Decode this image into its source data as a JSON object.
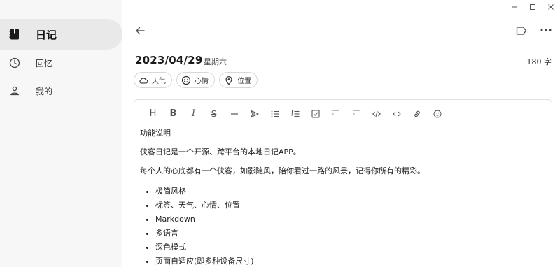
{
  "window": {
    "controls": [
      "minimize",
      "maximize",
      "close"
    ]
  },
  "sidebar": {
    "items": [
      {
        "label": "日记",
        "icon": "journal-icon",
        "active": true
      },
      {
        "label": "回忆",
        "icon": "clock-icon",
        "active": false
      },
      {
        "label": "我的",
        "icon": "person-icon",
        "active": false
      }
    ]
  },
  "entry": {
    "date": "2023/04/29",
    "weekday": "星期六",
    "word_count": "180 字",
    "chips": [
      {
        "label": "天气",
        "icon": "cloud-icon"
      },
      {
        "label": "心情",
        "icon": "smiley-icon"
      },
      {
        "label": "位置",
        "icon": "location-pin-icon"
      }
    ]
  },
  "toolbar": {
    "heading": "H",
    "bold": "B",
    "italic": "I",
    "strike": "S"
  },
  "content": {
    "title": "功能说明",
    "para1": "侠客日记是一个开源、跨平台的本地日记APP。",
    "para2": "每个人的心底都有一个侠客，如影随风，陪你看过一路的风景，记得你所有的精彩。",
    "features": [
      "极简风格",
      "标签、天气、心情、位置",
      "Markdown",
      "多语言",
      "深色模式",
      "页面自适应(即多种设备尺寸)"
    ]
  },
  "colors": {
    "sidebar_bg": "#f7f7f7",
    "active_bg": "#e9e9e9",
    "border": "#e0e0e0"
  }
}
